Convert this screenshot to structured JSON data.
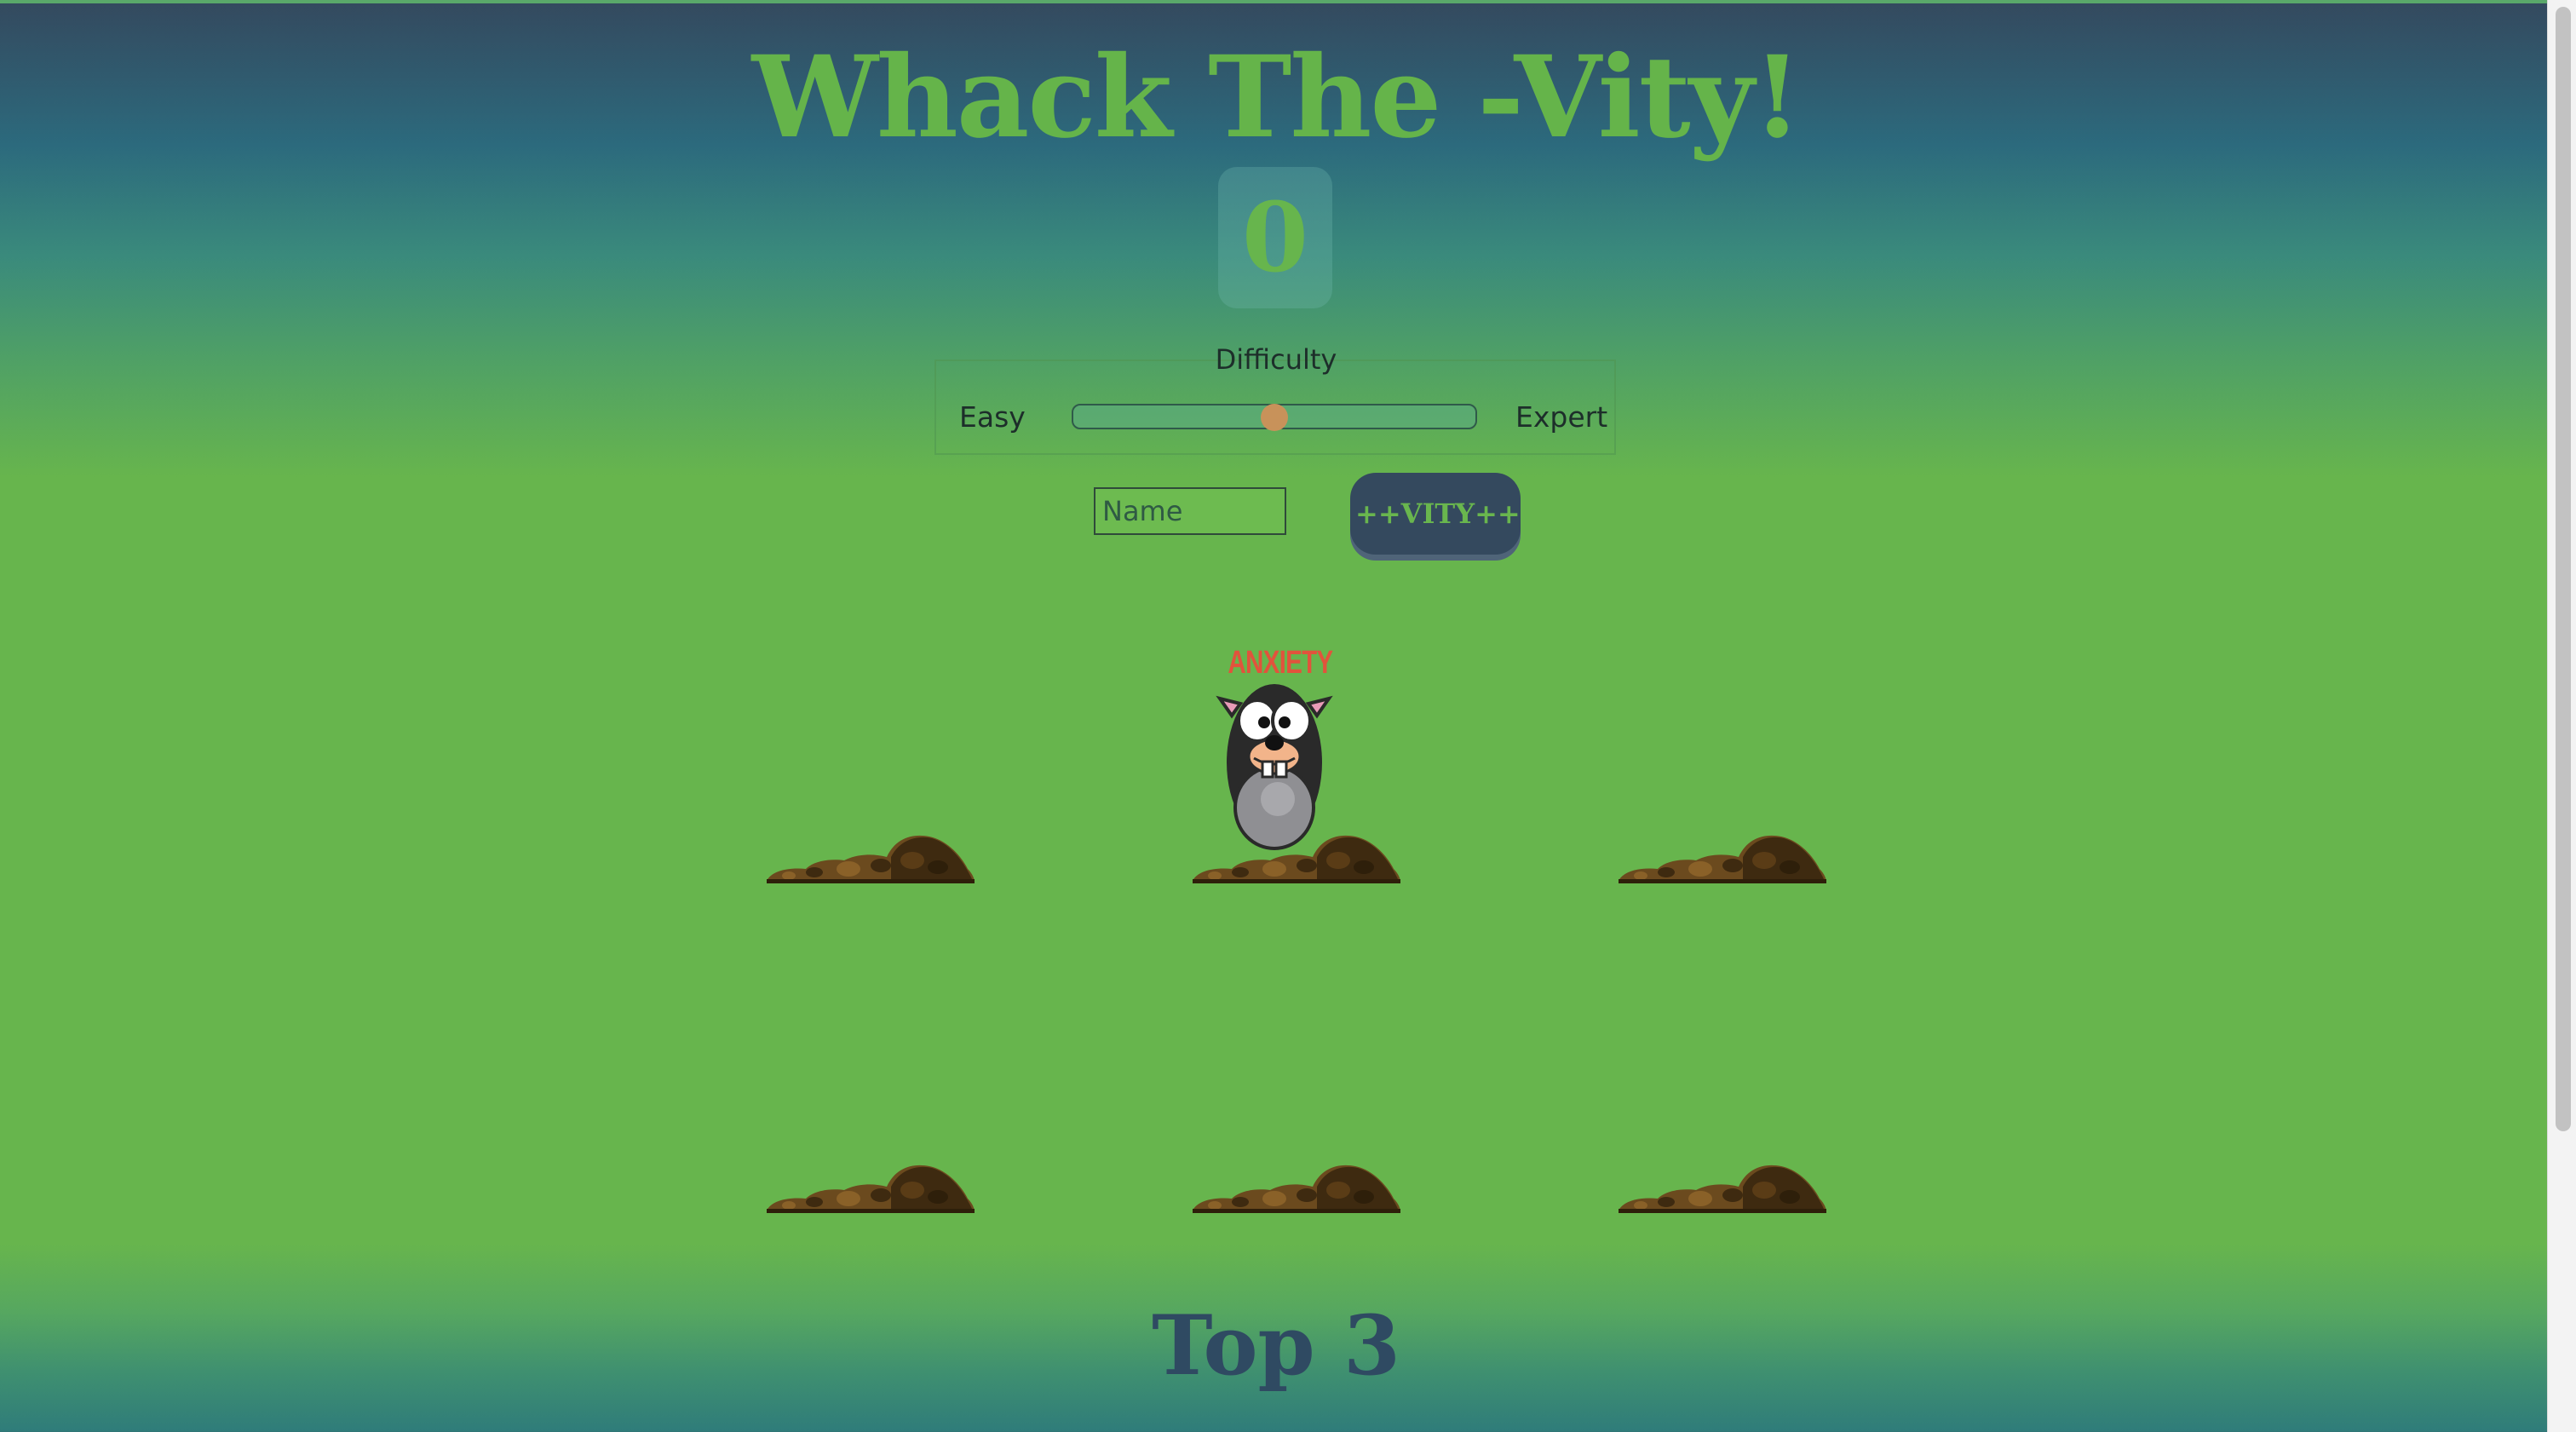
{
  "game": {
    "title": "Whack The -Vity!",
    "score": "0"
  },
  "difficulty": {
    "legend": "Difficulty",
    "min_label": "Easy",
    "max_label": "Expert",
    "value_fraction": 0.5
  },
  "player": {
    "name_placeholder": "Name",
    "name_value": ""
  },
  "start_button": {
    "label": "++VITY++"
  },
  "board": {
    "active_mole_label": "ANXIETY"
  },
  "leaderboard": {
    "title": "Top 3"
  },
  "colors": {
    "title": "#65b44a",
    "grass": "#67b54d",
    "dark_blue": "#34495e",
    "slider_thumb": "#c8925a",
    "mole_label": "#e2533c"
  }
}
